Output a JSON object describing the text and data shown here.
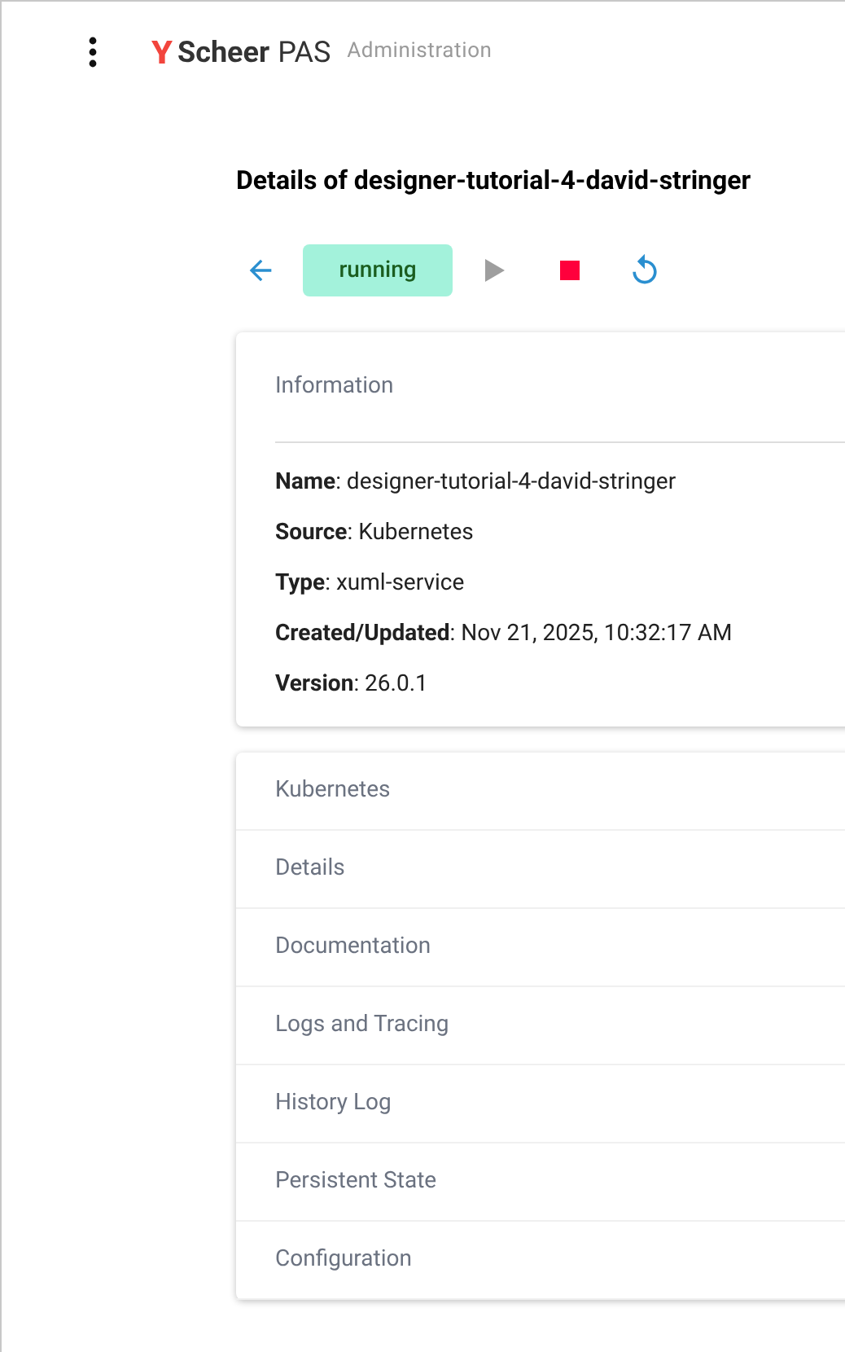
{
  "header": {
    "brand": "Scheer",
    "brand_suffix": "PAS",
    "section": "Administration"
  },
  "title": "Details of designer-tutorial-4-david-stringer",
  "status": "running",
  "actions": [
    {
      "kind": "back",
      "disabled": false
    },
    {
      "kind": "start",
      "disabled": true
    },
    {
      "kind": "stop",
      "disabled": false
    },
    {
      "kind": "restart",
      "disabled": false
    }
  ],
  "information": {
    "title": "Information",
    "fields": [
      "**Name**: designer-tutorial-4-david-stringer",
      "**Source**: Kubernetes",
      "**Type**: xuml-service",
      "**Created/Updated**: Nov 21, 2025, 10:32:17 AM",
      "**Version**: 26.0.1"
    ]
  },
  "panels": [
    "Kubernetes",
    "Details",
    "Documentation",
    "Logs and Tracing",
    "History Log",
    "Persistent State",
    "Configuration"
  ]
}
